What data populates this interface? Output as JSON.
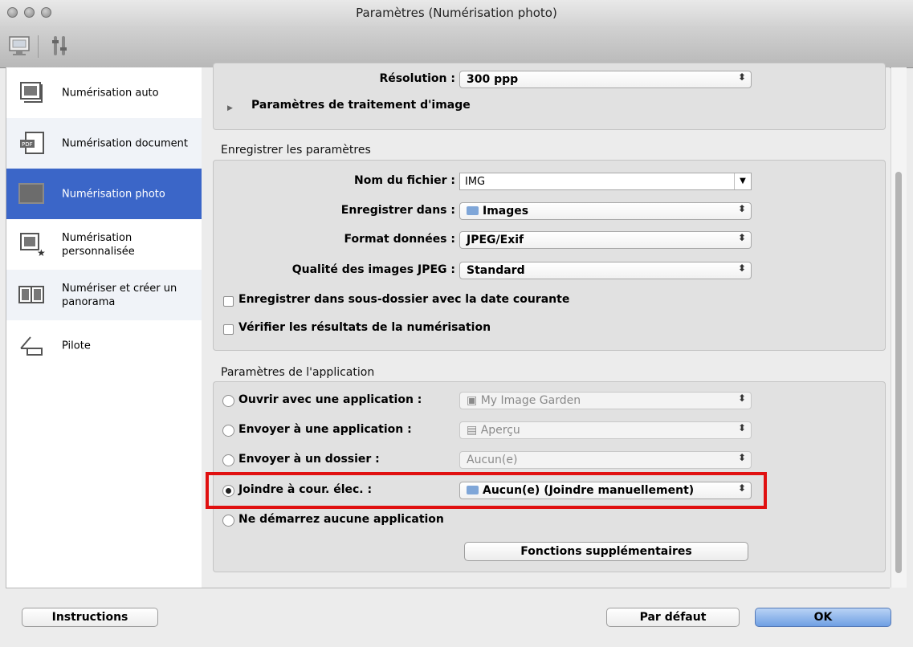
{
  "window": {
    "title": "Paramètres (Numérisation photo)"
  },
  "sidebar": {
    "items": [
      {
        "label": "Numérisation auto",
        "icon": "auto-scan-icon"
      },
      {
        "label": "Numérisation document",
        "icon": "document-scan-icon"
      },
      {
        "label": "Numérisation photo",
        "icon": "photo-scan-icon",
        "selected": true
      },
      {
        "label": "Numérisation\npersonnalisée",
        "icon": "custom-scan-icon"
      },
      {
        "label": "Numériser et créer un\npanorama",
        "icon": "panorama-icon"
      },
      {
        "label": "Pilote",
        "icon": "driver-icon"
      }
    ]
  },
  "scan_settings": {
    "resolution_label": "Résolution :",
    "resolution_value": "300 ppp",
    "image_processing_label": "Paramètres de traitement d'image"
  },
  "save_settings": {
    "group_title": "Enregistrer les paramètres",
    "filename_label": "Nom du fichier :",
    "filename_value": "IMG",
    "save_in_label": "Enregistrer dans :",
    "save_in_value": "Images",
    "format_label": "Format données :",
    "format_value": "JPEG/Exif",
    "jpeg_quality_label": "Qualité des images JPEG :",
    "jpeg_quality_value": "Standard",
    "subfolder_label": "Enregistrer dans sous-dossier avec la date courante",
    "verify_label": "Vérifier les résultats de la numérisation"
  },
  "app_settings": {
    "group_title": "Paramètres de l'application",
    "options": [
      {
        "label": "Ouvrir avec une application :",
        "value": "My Image Garden",
        "enabled": false
      },
      {
        "label": "Envoyer à une application :",
        "value": "Aperçu",
        "enabled": false
      },
      {
        "label": "Envoyer à un dossier :",
        "value": "Aucun(e)",
        "enabled": false
      },
      {
        "label": "Joindre à cour. élec. :",
        "value": "Aucun(e) (Joindre manuellement)",
        "enabled": true,
        "selected": true
      },
      {
        "label": "Ne démarrez aucune application"
      }
    ],
    "more_functions_label": "Fonctions supplémentaires"
  },
  "footer": {
    "instructions_label": "Instructions",
    "default_label": "Par défaut",
    "ok_label": "OK"
  },
  "colors": {
    "selection": "#3b66c8",
    "highlight_box": "#e01010"
  }
}
